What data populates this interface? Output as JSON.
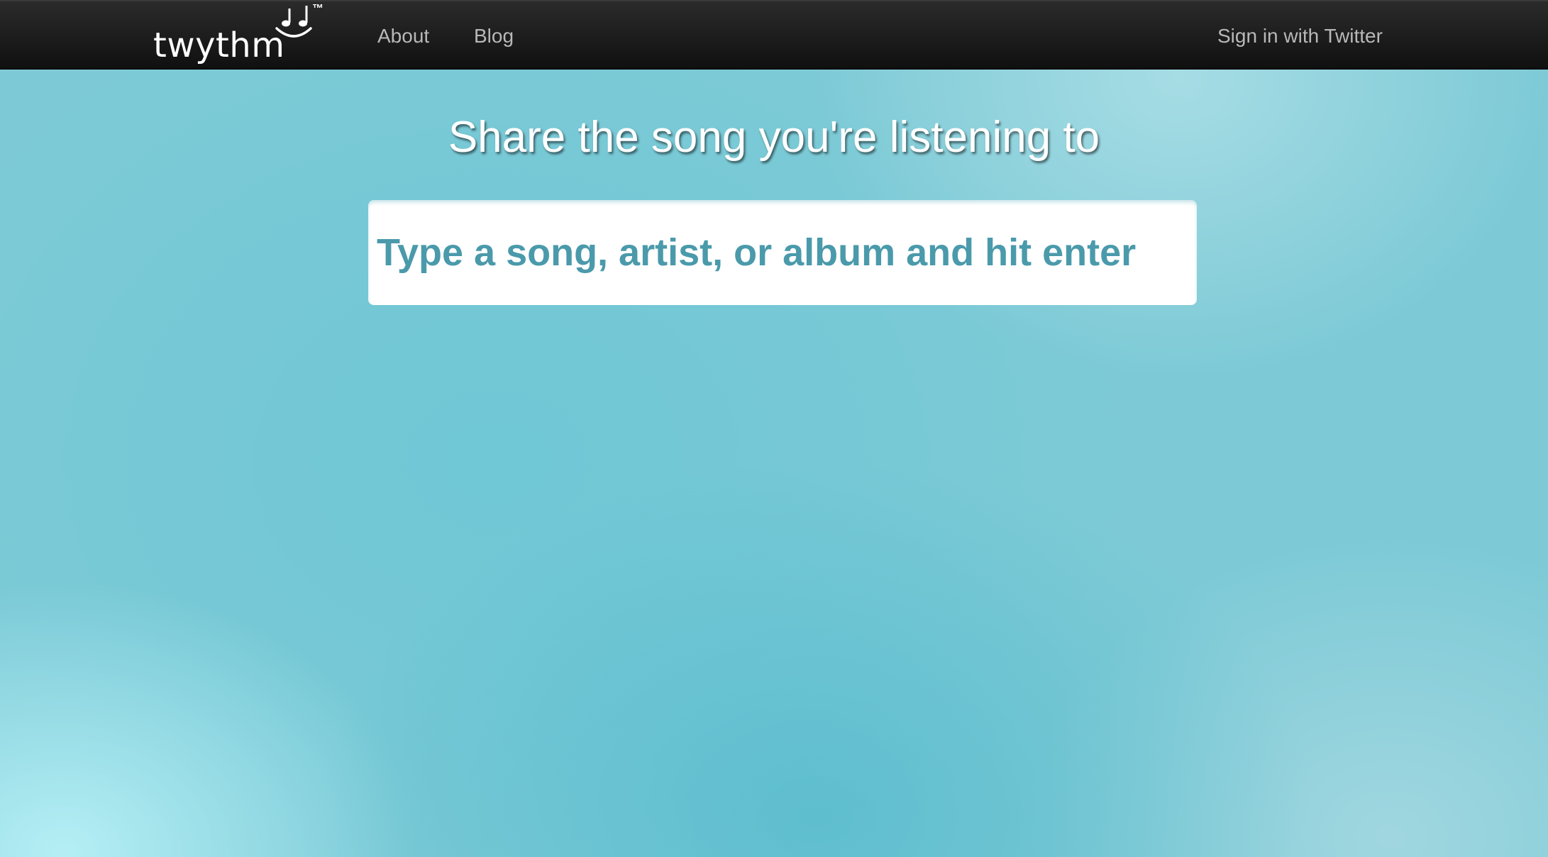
{
  "navbar": {
    "brand": {
      "name": "twythm",
      "trademark": "™",
      "icon": "music-notes-smile-icon"
    },
    "links": {
      "about": "About",
      "blog": "Blog",
      "signin": "Sign in with Twitter"
    }
  },
  "main": {
    "headline": "Share the song you're listening to",
    "search": {
      "placeholder": "Type a song, artist, or album and hit enter",
      "value": ""
    }
  },
  "colors": {
    "navbar": "#1a1a1a",
    "background": "#7dcad6",
    "input_text": "#4a9aab",
    "nav_link": "#b8b8b8"
  }
}
